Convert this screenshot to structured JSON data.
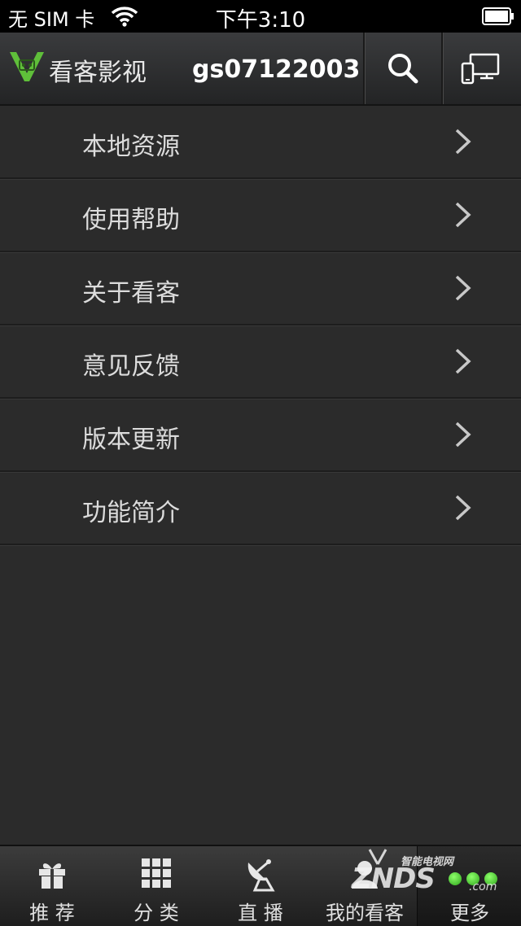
{
  "status_bar": {
    "carrier": "无 SIM 卡",
    "time": "下午3:10"
  },
  "header": {
    "logo_text": "看客影视",
    "username": "gs07122003",
    "accent_color": "#5fbf3a"
  },
  "menu": {
    "items": [
      {
        "label": "本地资源"
      },
      {
        "label": "使用帮助"
      },
      {
        "label": "关于看客"
      },
      {
        "label": "意见反馈"
      },
      {
        "label": "版本更新"
      },
      {
        "label": "功能简介"
      }
    ]
  },
  "tabbar": {
    "tabs": [
      {
        "label": "推 荐",
        "icon": "gift-icon"
      },
      {
        "label": "分 类",
        "icon": "grid-icon"
      },
      {
        "label": "直 播",
        "icon": "satellite-dish-icon"
      },
      {
        "label": "我的看客",
        "icon": "user-icon"
      },
      {
        "label": "更多",
        "icon": "more-dots-icon",
        "active": true
      }
    ]
  },
  "watermark": {
    "subtitle": "智能电视网",
    "brand": "ZNDS",
    "domain": ".com"
  }
}
